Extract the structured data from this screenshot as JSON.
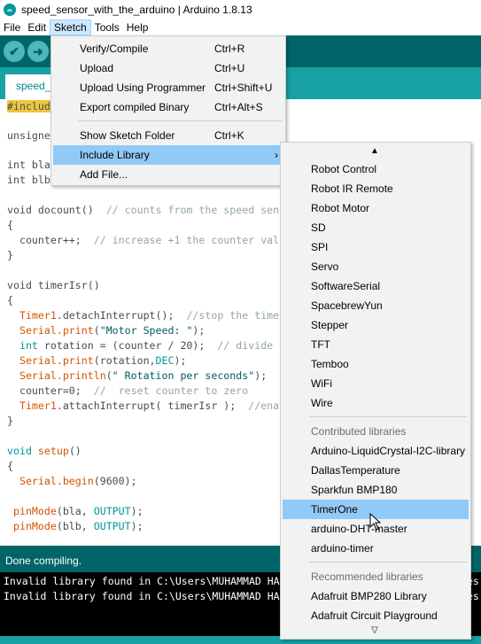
{
  "window": {
    "title": "speed_sensor_with_the_arduino | Arduino 1.8.13"
  },
  "menubar": {
    "items": [
      "File",
      "Edit",
      "Sketch",
      "Tools",
      "Help"
    ]
  },
  "toolbar": {
    "verify_glyph": "✔",
    "upload_glyph": "➜"
  },
  "tab": {
    "label": "speed_sensor_with_the_arduino"
  },
  "sketch_menu": {
    "items": [
      {
        "label": "Verify/Compile",
        "shortcut": "Ctrl+R"
      },
      {
        "label": "Upload",
        "shortcut": "Ctrl+U"
      },
      {
        "label": "Upload Using Programmer",
        "shortcut": "Ctrl+Shift+U"
      },
      {
        "label": "Export compiled Binary",
        "shortcut": "Ctrl+Alt+S"
      },
      {
        "label": "Show Sketch Folder",
        "shortcut": "Ctrl+K"
      },
      {
        "label": "Include Library",
        "shortcut": ""
      },
      {
        "label": "Add File...",
        "shortcut": ""
      }
    ],
    "submenu_arrow": "›"
  },
  "library_submenu": {
    "scroll_up": "▲",
    "scroll_down": "▽",
    "items": [
      "Robot Control",
      "Robot IR Remote",
      "Robot Motor",
      "SD",
      "SPI",
      "Servo",
      "SoftwareSerial",
      "SpacebrewYun",
      "Stepper",
      "TFT",
      "Temboo",
      "WiFi",
      "Wire"
    ],
    "contributed_header": "Contributed libraries",
    "contributed": [
      "Arduino-LiquidCrystal-I2C-library",
      "DallasTemperature",
      "Sparkfun BMP180",
      "TimerOne",
      "arduino-DHT-master",
      "arduino-timer"
    ],
    "recommended_header": "Recommended libraries",
    "recommended": [
      "Adafruit BMP280 Library",
      "Adafruit Circuit Playground"
    ]
  },
  "code": {
    "l1": "#includ",
    "l2": "unsigne",
    "l3": "int bla",
    "l4": "int blb",
    "l5a": "void docount()  ",
    "l5b": "// counts from the speed sen",
    "l6": "{",
    "l7a": "  counter++;  ",
    "l7b": "// increase +1 the counter val",
    "l8": "}",
    "l9": "void timerIsr()",
    "l10": "{",
    "l11a": "  Timer1",
    "l11b": ".detachInterrupt",
    "l11c": "();  ",
    "l11d": "//stop the time",
    "l12a": "  Serial",
    "l12b": ".print",
    "l12c": "(",
    "l12d": "\"Motor Speed: \"",
    "l12e": ");",
    "l13a": "  int",
    "l13b": " rotation = (counter / 20);  ",
    "l13c": "// divide",
    "l14a": "  Serial",
    "l14b": ".print",
    "l14c": "(rotation,",
    "l14d": "DEC",
    "l14e": ");",
    "l15a": "  Serial",
    "l15b": ".println",
    "l15c": "(",
    "l15d": "\" Rotation per seconds\"",
    "l15e": ");",
    "l16a": "  counter=0;  ",
    "l16b": "//  reset counter to zero",
    "l17a": "  Timer1",
    "l17b": ".attachInterrupt",
    "l17c": "( timerIsr );  ",
    "l17d": "//ena",
    "l18": "}",
    "l19a": "void",
    "l19b": " setup",
    "l19c": "()",
    "l20": "{",
    "l21a": "  Serial",
    "l21b": ".begin",
    "l21c": "(9600);",
    "l22a": " pinMode",
    "l22b": "(bla, ",
    "l22c": "OUTPUT",
    "l22d": ");",
    "l23a": " pinMode",
    "l23b": "(blb, ",
    "l23c": "OUTPUT",
    "l23d": ");"
  },
  "status": {
    "text": "Done compiling."
  },
  "console": {
    "lines": [
      "Invalid library found in C:\\Users\\MUHAMMAD HA",
      "Invalid library found in C:\\Users\\MUHAMMAD HA"
    ],
    "tail1": "es",
    "tail2": "es"
  },
  "colors": {
    "teal_dark": "#006468",
    "teal": "#17a1a5",
    "highlight": "#91c9f7"
  }
}
